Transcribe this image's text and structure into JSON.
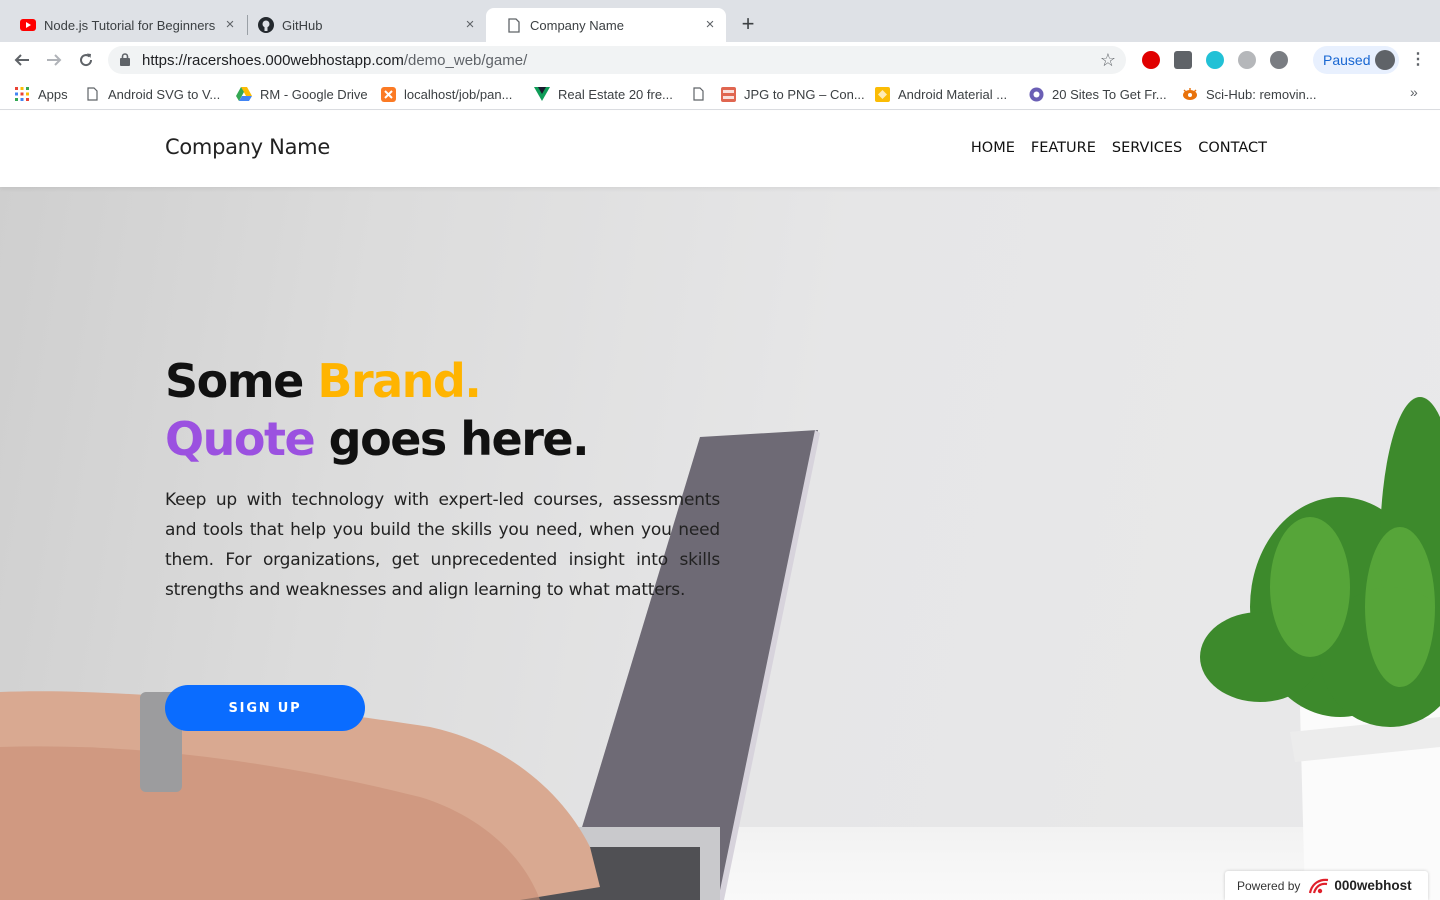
{
  "browser": {
    "tabs": [
      {
        "title": "Node.js Tutorial for Beginners:",
        "icon": "youtube-icon",
        "active": false
      },
      {
        "title": "GitHub",
        "icon": "github-icon",
        "active": false
      },
      {
        "title": "Company Name",
        "icon": "page-icon",
        "active": true
      }
    ],
    "new_tab_glyph": "+",
    "close_glyph": "×",
    "url_host": "https://racershoes.000webhostapp.com",
    "url_path": "/demo_web/game/",
    "profile_label": "Paused",
    "bookmarks": [
      {
        "label": "Apps",
        "icon": "apps-grid-icon"
      },
      {
        "label": "Android SVG to V...",
        "icon": "page-icon"
      },
      {
        "label": "RM - Google Drive",
        "icon": "google-drive-icon"
      },
      {
        "label": "localhost/job/pan...",
        "icon": "xampp-icon"
      },
      {
        "label": "Real Estate 20 fre...",
        "icon": "vue-icon"
      },
      {
        "label": "",
        "icon": "page-icon"
      },
      {
        "label": "JPG to PNG – Con...",
        "icon": "jpg-png-icon"
      },
      {
        "label": "Android Material ...",
        "icon": "material-icon"
      },
      {
        "label": "20 Sites To Get Fr...",
        "icon": "site-icon"
      },
      {
        "label": "Sci-Hub: removin...",
        "icon": "scihub-icon"
      }
    ],
    "more_bookmarks_glyph": "»"
  },
  "site": {
    "brand": "Company Name",
    "nav": [
      "HOME",
      "FEATURE",
      "SERVICES",
      "CONTACT"
    ],
    "headline": {
      "line1_a": "Some ",
      "line1_b": "Brand.",
      "line2_a": "Quote",
      "line2_b": " goes here."
    },
    "description": "Keep up with technology with expert-led courses, assessments and tools that help you build the skills you need, when you need them. For organizations, get unprecedented insight into skills strengths and weaknesses and align learning to what matters.",
    "cta": "SIGN UP",
    "powered_by": "Powered by",
    "host_brand": "000webhost"
  },
  "colors": {
    "accent_yellow": "#ffb400",
    "accent_purple": "#9b51e0",
    "cta_blue": "#0a6cff"
  }
}
